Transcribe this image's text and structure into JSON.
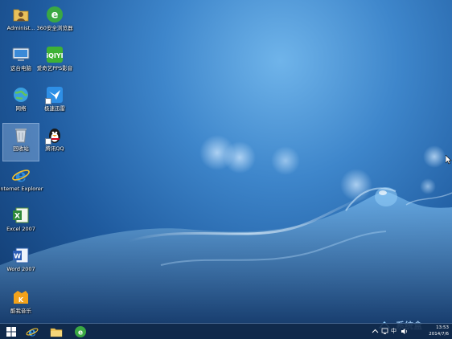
{
  "desktop": {
    "icons": [
      {
        "name": "administrator-folder",
        "label": "Administ...",
        "icon": "user-folder-icon"
      },
      {
        "name": "360-browser",
        "label": "360安全浏览器",
        "icon": "360-browser-icon"
      },
      {
        "name": "this-pc",
        "label": "这台电脑",
        "icon": "computer-icon"
      },
      {
        "name": "iqiyi-pps",
        "label": "爱奇艺PPS影音",
        "icon": "iqiyi-icon"
      },
      {
        "name": "network",
        "label": "网络",
        "icon": "network-globe-icon"
      },
      {
        "name": "xunlei",
        "label": "极速迅雷",
        "icon": "thunder-bird-icon"
      },
      {
        "name": "recycle-bin",
        "label": "回收站",
        "icon": "recycle-bin-icon"
      },
      {
        "name": "tencent-qq",
        "label": "腾讯QQ",
        "icon": "qq-penguin-icon"
      },
      {
        "name": "internet-explorer",
        "label": "Internet Explorer",
        "icon": "internet-explorer-icon"
      },
      {
        "name": "excel-2007",
        "label": "Excel 2007",
        "icon": "excel-icon"
      },
      {
        "name": "word-2007",
        "label": "Word 2007",
        "icon": "word-icon"
      },
      {
        "name": "kuwo-music",
        "label": "酷我音乐",
        "icon": "kuwo-music-icon"
      }
    ],
    "selected_icon": "recycle-bin"
  },
  "taskbar": {
    "buttons": [
      {
        "name": "start",
        "icon": "windows-start-icon"
      },
      {
        "name": "ie",
        "icon": "internet-explorer-icon"
      },
      {
        "name": "explorer",
        "icon": "file-explorer-icon"
      },
      {
        "name": "360",
        "icon": "360-browser-icon"
      }
    ],
    "tray": {
      "icons": [
        "up-arrow-icon",
        "network-icon",
        "ime-cn-icon",
        "volume-icon"
      ],
      "ime_label": "中",
      "time": "13:53",
      "date": "2014/7/6"
    }
  },
  "watermark": {
    "text": "系统盒"
  },
  "colors": {
    "desktop_base": "#1f5b9f",
    "taskbar": "#10284a",
    "accent": "#3e86cb"
  }
}
